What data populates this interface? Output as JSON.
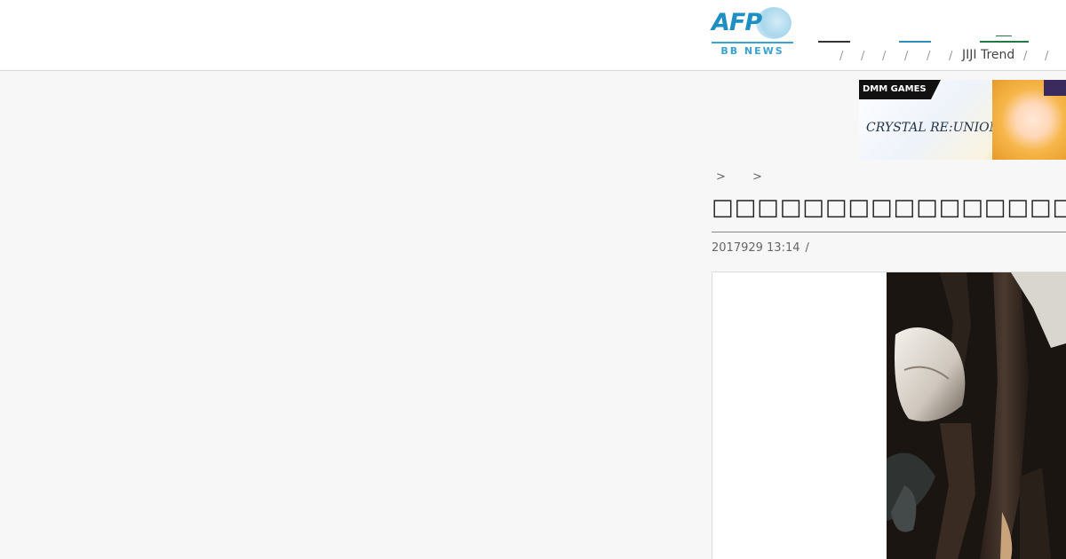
{
  "header": {
    "logo": {
      "brand": "AFP",
      "sub": "BB NEWS"
    },
    "nav_separators": [
      "/",
      "/",
      "/",
      "/",
      "/",
      "/",
      "/"
    ],
    "nav_link": "JIJI Trend"
  },
  "ad": {
    "label": "DMM GAMES",
    "game_logo": "CRYSTAL RE:UNION"
  },
  "breadcrumb": [
    ">",
    ">"
  ],
  "article": {
    "title": "□□□□□□□□□□□□□□□□□□□□□□□",
    "date": "2017929 13:14",
    "date_sep": "/"
  },
  "colors": {
    "page_bg": "#f7f7f7",
    "afp_blue": "#1e8fc4",
    "nav_green": "#1f7a45",
    "nav_blue": "#2c8fbf"
  },
  "icons": [
    "afp-globe-icon"
  ]
}
